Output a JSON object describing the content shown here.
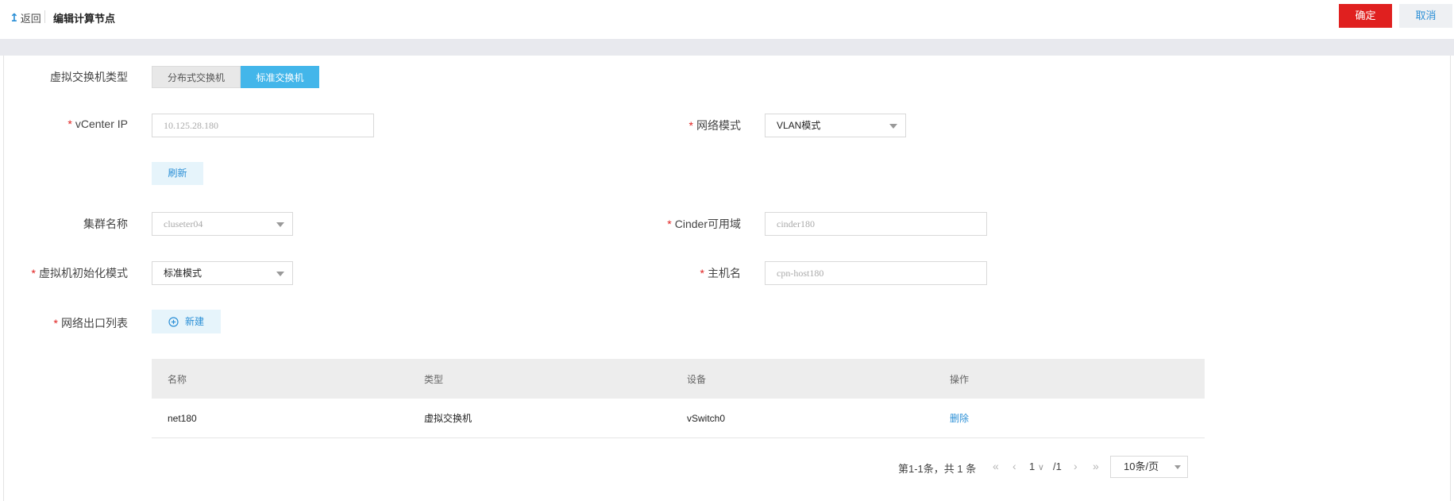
{
  "header": {
    "back_label": "返回",
    "title": "编辑计算节点",
    "ok_label": "确定",
    "cancel_label": "取消"
  },
  "form": {
    "vswitch_type": {
      "label": "虚拟交换机类型",
      "options": [
        "分布式交换机",
        "标准交换机"
      ],
      "selected": "标准交换机"
    },
    "vcenter_ip": {
      "label": "vCenter IP",
      "value": "10.125.28.180",
      "required": true
    },
    "network_mode": {
      "label": "网络模式",
      "value": "VLAN模式",
      "required": true
    },
    "refresh_label": "刷新",
    "cluster_name": {
      "label": "集群名称",
      "value": "cluseter04"
    },
    "cinder_az": {
      "label": "Cinder可用域",
      "value": "cinder180",
      "required": true
    },
    "vm_init_mode": {
      "label": "虚拟机初始化模式",
      "value": "标准模式",
      "required": true
    },
    "hostname": {
      "label": "主机名",
      "value": "cpn-host180",
      "required": true
    },
    "egress_list": {
      "label": "网络出口列表",
      "required": true,
      "new_label": "新建"
    }
  },
  "table": {
    "columns": [
      "名称",
      "类型",
      "设备",
      "操作"
    ],
    "rows": [
      {
        "name": "net180",
        "type": "虚拟交换机",
        "device": "vSwitch0",
        "action": "删除"
      }
    ]
  },
  "pagination": {
    "info": "第1-1条，共 1 条",
    "page": "1",
    "total": "/1",
    "page_size": "10条/页"
  },
  "icons": {
    "back": "arrow-up-icon",
    "add": "plus-circle-icon",
    "first": "double-chevron-left-icon",
    "prev": "chevron-left-icon",
    "next": "chevron-right-icon",
    "last": "double-chevron-right-icon"
  },
  "colors": {
    "primary": "#e0201f",
    "accent": "#43b6ea",
    "link": "#2b8fd6"
  }
}
